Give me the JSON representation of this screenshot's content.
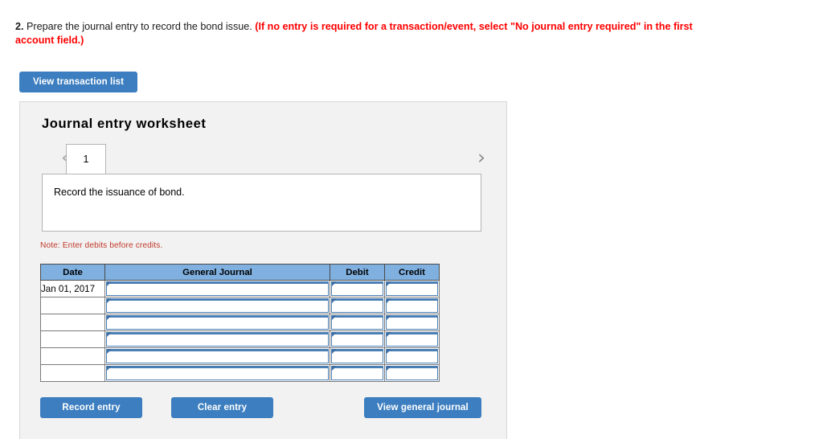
{
  "question": {
    "number": "2.",
    "text": " Prepare the journal entry to record the bond issue. ",
    "red_note": "(If no entry is required for a transaction/event, select \"No journal entry required\" in the first account field.)"
  },
  "toolbar": {
    "view_transaction_list": "View transaction list"
  },
  "worksheet": {
    "title": "Journal entry worksheet",
    "prev_arrow": "‹",
    "next_arrow": "›",
    "tabs": [
      {
        "label": "1",
        "active": true
      }
    ],
    "description": "Record the issuance of bond.",
    "note": "Note: Enter debits before credits."
  },
  "table": {
    "headers": [
      "Date",
      "General Journal",
      "Debit",
      "Credit"
    ],
    "rows": [
      {
        "date": "Jan 01, 2017",
        "general_journal": "",
        "debit": "",
        "credit": ""
      },
      {
        "date": "",
        "general_journal": "",
        "debit": "",
        "credit": ""
      },
      {
        "date": "",
        "general_journal": "",
        "debit": "",
        "credit": ""
      },
      {
        "date": "",
        "general_journal": "",
        "debit": "",
        "credit": ""
      },
      {
        "date": "",
        "general_journal": "",
        "debit": "",
        "credit": ""
      },
      {
        "date": "",
        "general_journal": "",
        "debit": "",
        "credit": ""
      }
    ]
  },
  "actions": {
    "record_entry": "Record entry",
    "clear_entry": "Clear entry",
    "view_general_journal": "View general journal"
  },
  "colors": {
    "button_blue": "#3c7ebf",
    "table_header_blue": "#7fb0e0",
    "field_border_blue": "#4a7fb5",
    "note_red": "#c0392b",
    "alert_red": "#ff0000",
    "panel_gray": "#f2f2f2"
  }
}
